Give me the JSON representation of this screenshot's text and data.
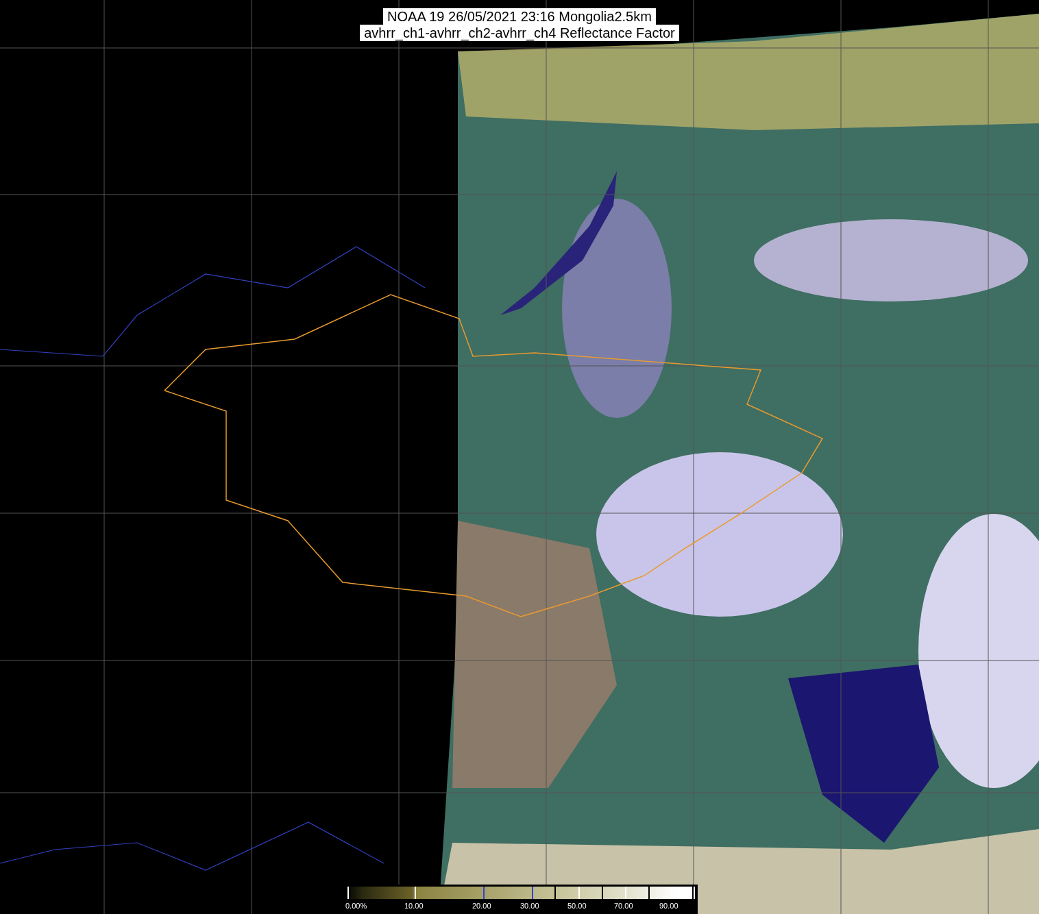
{
  "title": {
    "lines": [
      "NOAA 19 26/05/2021 23:16 Mongolia2.5km",
      "avhrr_ch1-avhrr_ch2-avhrr_ch4 Reflectance Factor"
    ]
  },
  "colorbar": {
    "labels": [
      "0.00%",
      "10.00",
      "20.00",
      "30.00",
      "50.00",
      "70.00",
      "90.00"
    ]
  }
}
